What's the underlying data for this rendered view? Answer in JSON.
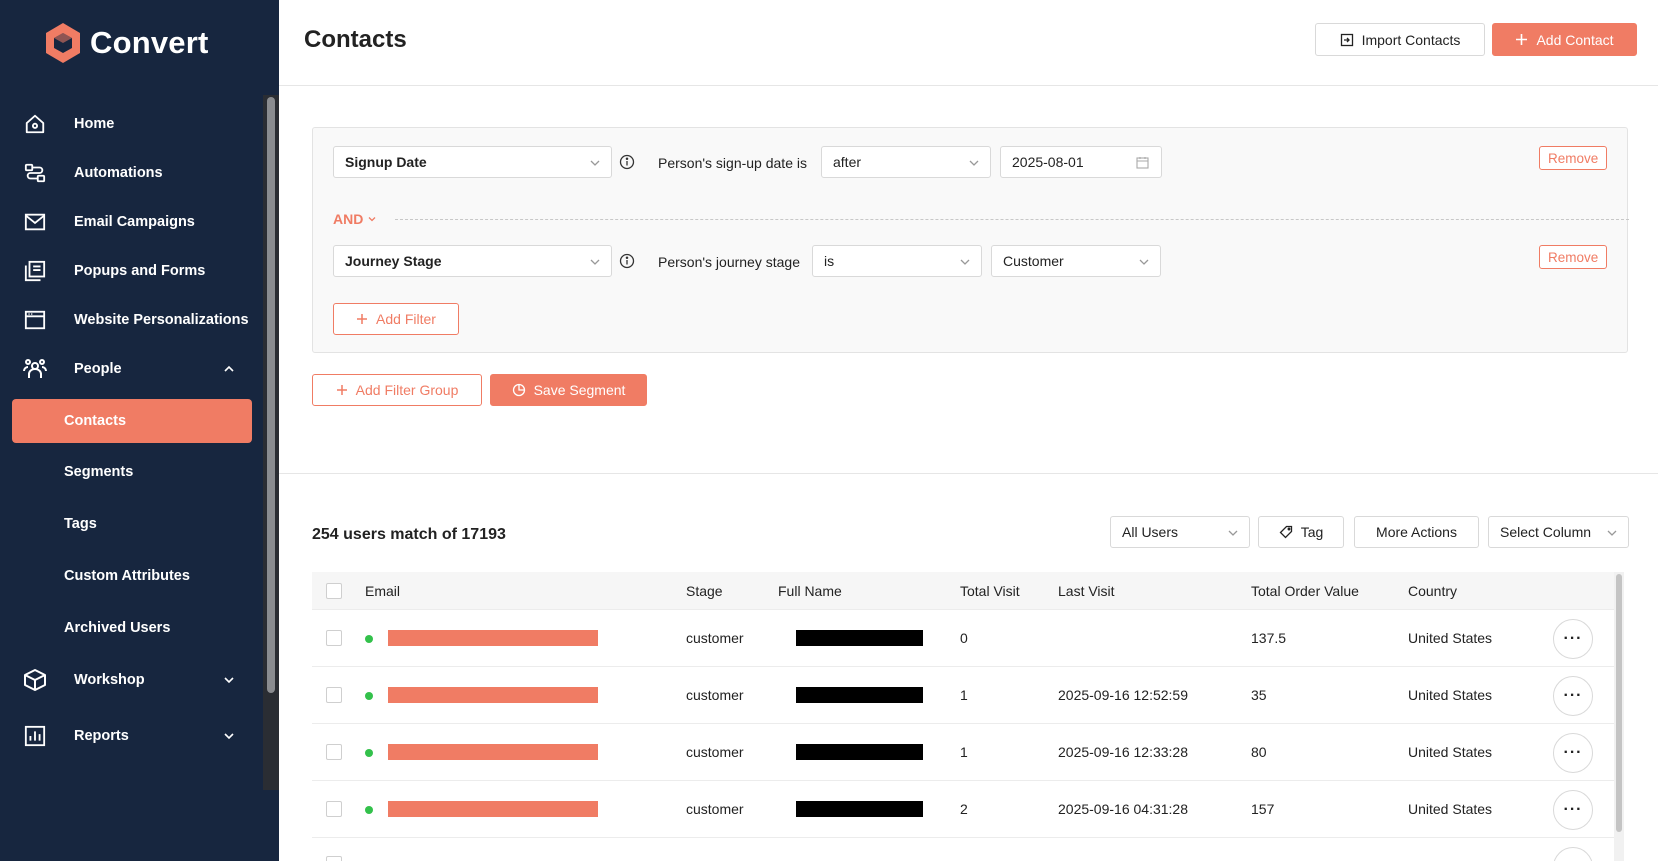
{
  "app": {
    "name": "Convert",
    "accent": "#f07c64",
    "sidebar_bg": "#17263f"
  },
  "sidebar": {
    "items": [
      {
        "label": "Home",
        "icon": "home-icon"
      },
      {
        "label": "Automations",
        "icon": "automations-icon"
      },
      {
        "label": "Email Campaigns",
        "icon": "mail-icon"
      },
      {
        "label": "Popups and Forms",
        "icon": "popups-icon"
      },
      {
        "label": "Website Personalizations",
        "icon": "browser-window-icon"
      },
      {
        "label": "People",
        "icon": "people-icon",
        "expanded": true
      },
      {
        "label": "Workshop",
        "icon": "cube-icon",
        "expanded": false
      },
      {
        "label": "Reports",
        "icon": "bar-chart-icon",
        "expanded": false
      }
    ],
    "people_sub": [
      {
        "label": "Contacts",
        "active": true
      },
      {
        "label": "Segments"
      },
      {
        "label": "Tags"
      },
      {
        "label": "Custom Attributes"
      },
      {
        "label": "Archived Users"
      }
    ]
  },
  "header": {
    "title": "Contacts",
    "import_label": "Import Contacts",
    "add_label": "Add Contact"
  },
  "filters": {
    "conditions": [
      {
        "field": "Signup Date",
        "description": "Person's sign-up date is",
        "operator": "after",
        "value": "2025-08-01",
        "remove_label": "Remove"
      },
      {
        "field": "Journey Stage",
        "description": "Person's journey stage",
        "operator": "is",
        "value": "Customer",
        "remove_label": "Remove"
      }
    ],
    "join_label": "AND",
    "add_filter_label": "Add Filter",
    "add_group_label": "Add Filter Group",
    "save_segment_label": "Save Segment"
  },
  "results": {
    "match_text": "254 users match of 17193",
    "user_filter": "All Users",
    "tag_label": "Tag",
    "more_actions_label": "More Actions",
    "select_column_label": "Select Column"
  },
  "table": {
    "columns": [
      "Email",
      "Stage",
      "Full Name",
      "Total Visit",
      "Last Visit",
      "Total Order Value",
      "Country"
    ],
    "rows": [
      {
        "stage": "customer",
        "total_visit": "0",
        "last_visit": "",
        "total_order_value": "137.5",
        "country": "United States"
      },
      {
        "stage": "customer",
        "total_visit": "1",
        "last_visit": "2025-09-16 12:52:59",
        "total_order_value": "35",
        "country": "United States"
      },
      {
        "stage": "customer",
        "total_visit": "1",
        "last_visit": "2025-09-16 12:33:28",
        "total_order_value": "80",
        "country": "United States"
      },
      {
        "stage": "customer",
        "total_visit": "2",
        "last_visit": "2025-09-16 04:31:28",
        "total_order_value": "157",
        "country": "United States"
      }
    ],
    "row_action": "···"
  }
}
